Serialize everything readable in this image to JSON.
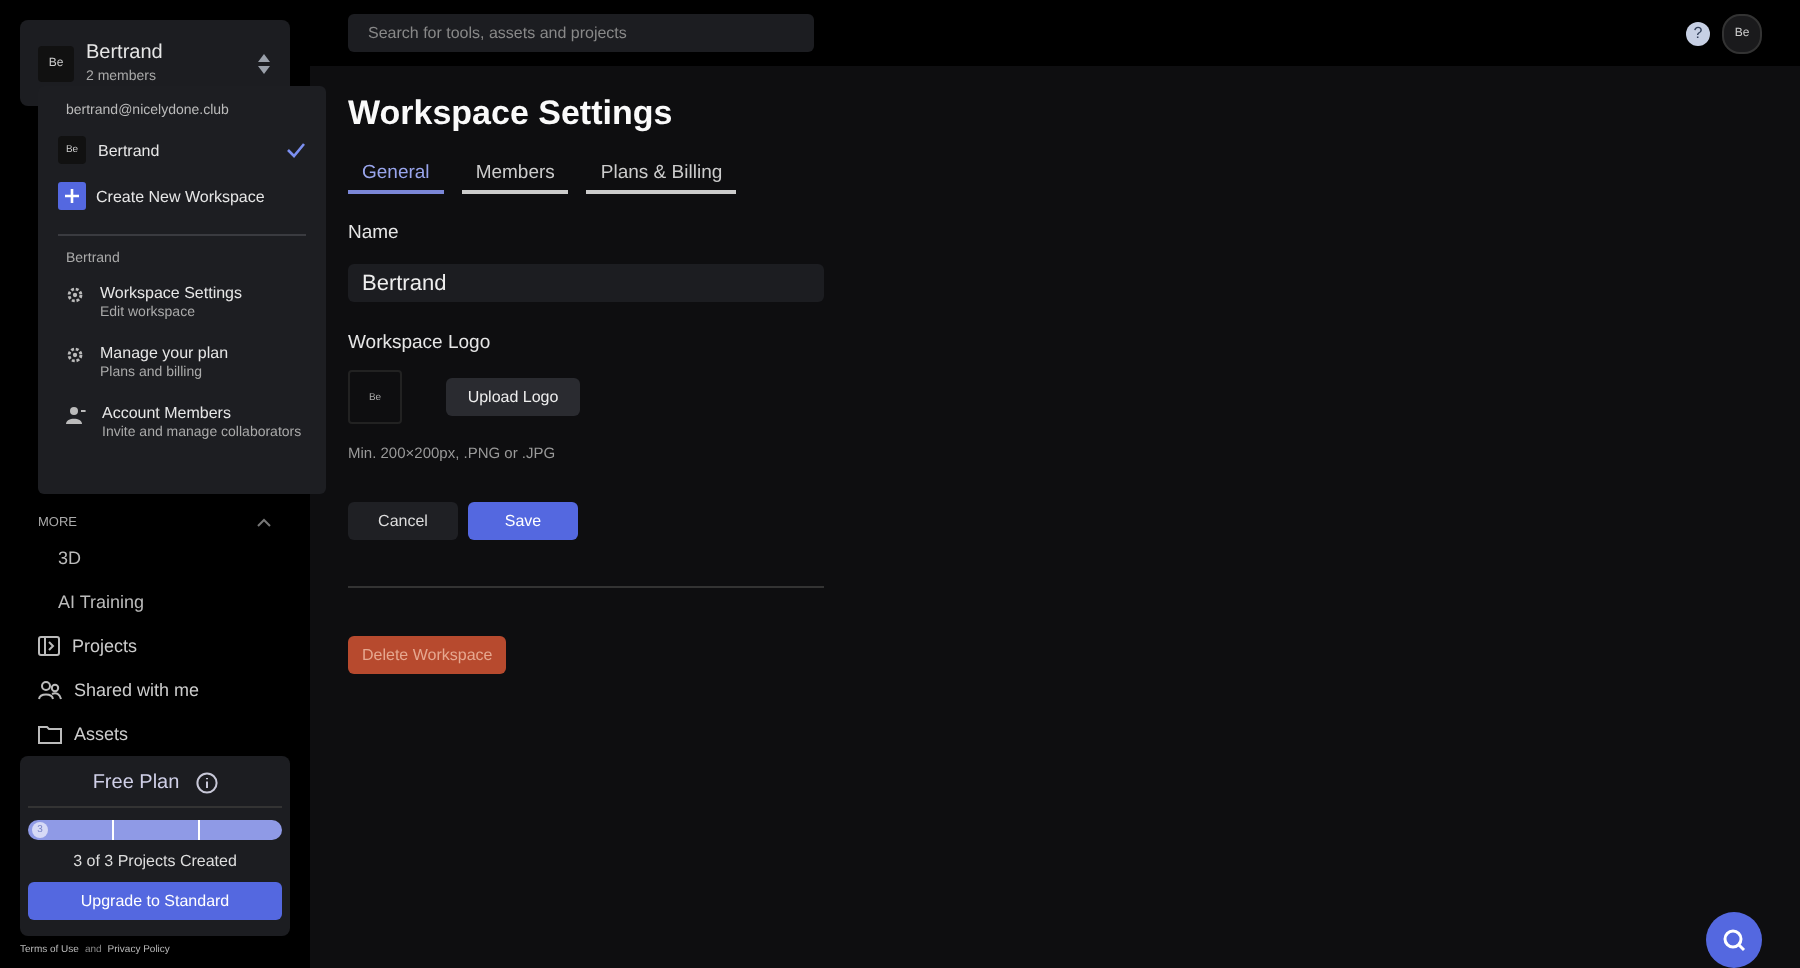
{
  "workspace_switcher": {
    "avatar": "Be",
    "name": "Bertrand",
    "members": "2 members"
  },
  "workspace_menu": {
    "email": "bertrand@nicelydone.club",
    "workspaces": [
      {
        "avatar": "Be",
        "name": "Bertrand",
        "selected": true
      }
    ],
    "create_label": "Create New Workspace",
    "section_title": "Bertrand",
    "items": [
      {
        "kind": "gear",
        "title": "Workspace Settings",
        "subtitle": "Edit workspace"
      },
      {
        "kind": "gear",
        "title": "Manage your plan",
        "subtitle": "Plans and billing"
      },
      {
        "kind": "person",
        "title": "Account Members",
        "subtitle": "Invite and manage collaborators"
      }
    ]
  },
  "sidebar": {
    "section": "MORE",
    "expanded": true,
    "sub_items": [
      "3D",
      "AI Training"
    ],
    "items": [
      {
        "kind": "projects",
        "label": "Projects"
      },
      {
        "kind": "shared",
        "label": "Shared with me"
      },
      {
        "kind": "folder",
        "label": "Assets"
      }
    ]
  },
  "plan_card": {
    "title": "Free Plan",
    "count_badge": "3",
    "level": 1,
    "progress_text": "3 of 3 Projects Created",
    "upgrade_button": "Upgrade to Standard"
  },
  "footer": {
    "terms": "Terms of Use",
    "and": "and",
    "privacy": "Privacy Policy"
  },
  "search": {
    "placeholder": "Search for tools, assets and projects"
  },
  "topbar": {
    "help": "?",
    "avatar": "Be"
  },
  "page": {
    "title": "Workspace Settings",
    "tabs": [
      {
        "label": "General",
        "selected": true
      },
      {
        "label": "Members",
        "selected": false
      },
      {
        "label": "Plans & Billing",
        "selected": false
      }
    ],
    "name_label": "Name",
    "name_value": "Bertrand",
    "logo_label": "Workspace Logo",
    "logo_avatar": "Be",
    "upload_button": "Upload Logo",
    "logo_hint": "Min. 200×200px, .PNG or .JPG",
    "cancel_button": "Cancel",
    "save_button": "Save",
    "delete_button": "Delete Workspace"
  }
}
